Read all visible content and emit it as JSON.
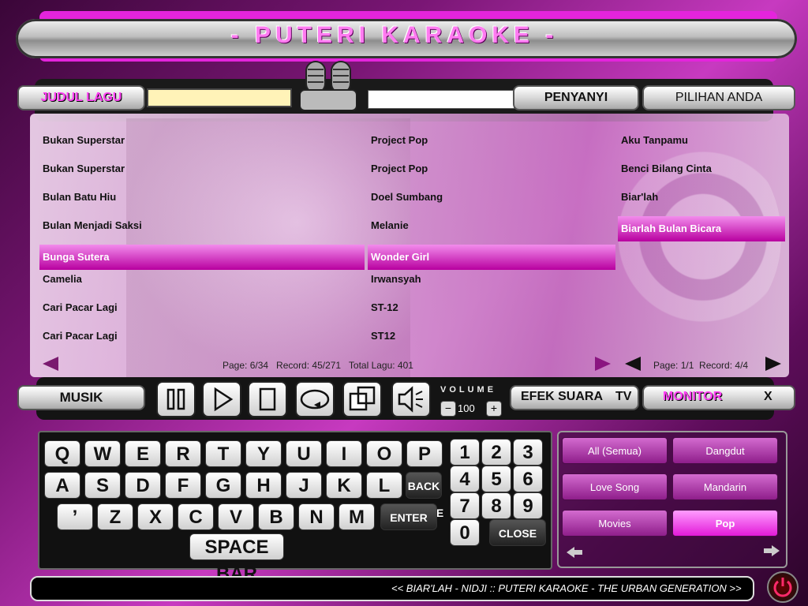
{
  "header": {
    "title": "- PUTERI KARAOKE -"
  },
  "search": {
    "title_tab": "JUDUL LAGU",
    "title_value": "",
    "singer_value": "",
    "singer_tab": "PENYANYI",
    "choice_tab": "PILIHAN ANDA"
  },
  "songs": {
    "titles": [
      "Bukan Superstar",
      "Bukan Superstar",
      "Bulan Batu Hiu",
      "Bulan Menjadi Saksi",
      "Bunga Sutera",
      "Camelia",
      "Cari Pacar Lagi",
      "Cari Pacar Lagi"
    ],
    "artists": [
      "Project Pop",
      "Project Pop",
      "Doel Sumbang",
      "Melanie",
      "Wonder Girl",
      "Irwansyah",
      "ST-12",
      "ST12"
    ],
    "selected_index": 4,
    "page_info": "Page: 6/34   Record: 45/271   Total Lagu: 401"
  },
  "choices": {
    "items": [
      "Aku Tanpamu",
      "Benci Bilang Cinta",
      "Biar'lah",
      "Biarlah Bulan Bicara"
    ],
    "selected_index": 3,
    "page_info": "Page: 1/1  Record: 4/4"
  },
  "controls": {
    "musik_label": "MUSIK",
    "volume_label": "VOLUME",
    "volume_value": "100",
    "vol_minus": "−",
    "vol_plus": "+",
    "efek_label": "EFEK SUARA",
    "tv_label": "TV",
    "monitor_label": "MONITOR",
    "x_label": "X"
  },
  "keyboard": {
    "row1": [
      "Q",
      "W",
      "E",
      "R",
      "T",
      "Y",
      "U",
      "I",
      "O",
      "P"
    ],
    "row2": [
      "A",
      "S",
      "D",
      "F",
      "G",
      "H",
      "J",
      "K",
      "L"
    ],
    "row3": [
      "’",
      "Z",
      "X",
      "C",
      "V",
      "B",
      "N",
      "M"
    ],
    "backspace": "BACK SPACE",
    "enter": "ENTER",
    "space": "SPACE BAR",
    "numbers": [
      "1",
      "2",
      "3",
      "4",
      "5",
      "6",
      "7",
      "8",
      "9",
      "0"
    ],
    "close": "CLOSE"
  },
  "genres": [
    {
      "label": "All (Semua)",
      "active": false
    },
    {
      "label": "Dangdut",
      "active": false
    },
    {
      "label": "Love Song",
      "active": false
    },
    {
      "label": "Mandarin",
      "active": false
    },
    {
      "label": "Movies",
      "active": false
    },
    {
      "label": "Pop",
      "active": true
    }
  ],
  "footer": {
    "marquee": "<< BIAR'LAH - NIDJI :: PUTERI KARAOKE - THE URBAN GENERATION >>"
  },
  "colors": {
    "accent": "#e424dc",
    "selection": "#b8009f"
  }
}
